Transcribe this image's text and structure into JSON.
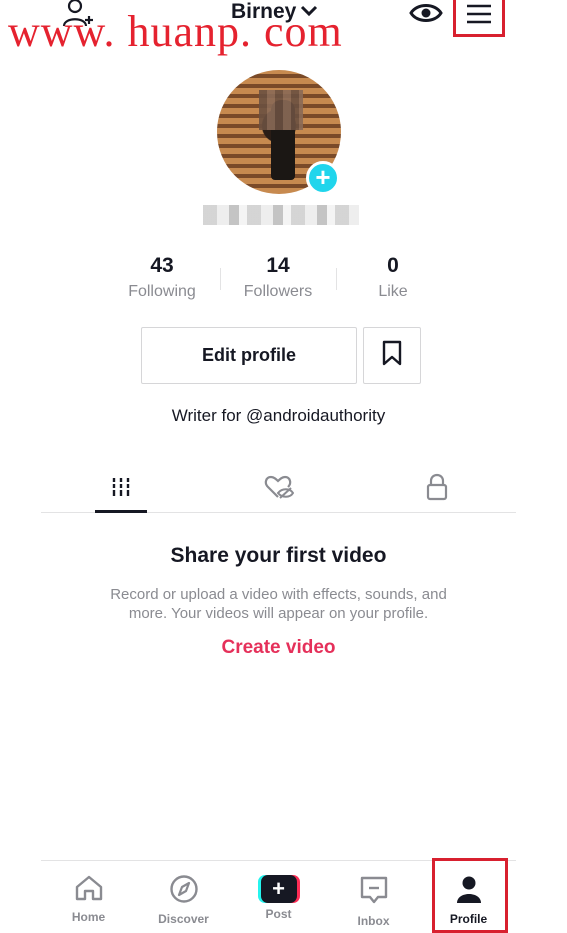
{
  "watermark": "www. huanp. com",
  "header": {
    "username": "Birney",
    "chevron": "chevron-down-icon",
    "left_icon": "add-user-icon",
    "right_icons": [
      "eye-icon",
      "menu-icon"
    ]
  },
  "profile": {
    "avatar_icon": "profile-photo",
    "add_icon": "+",
    "stats": [
      {
        "value": "43",
        "label": "Following"
      },
      {
        "value": "14",
        "label": "Followers"
      },
      {
        "value": "0",
        "label": "Like"
      }
    ],
    "edit_label": "Edit profile",
    "bookmark_icon": "bookmark-icon",
    "bio": "Writer for @androidauthority"
  },
  "tabs": [
    {
      "icon": "grid-icon",
      "active": true
    },
    {
      "icon": "liked-hidden-icon",
      "active": false
    },
    {
      "icon": "lock-icon",
      "active": false
    }
  ],
  "empty_state": {
    "title": "Share your first video",
    "description": "Record or upload a video with effects, sounds, and more. Your videos will appear on your profile.",
    "cta": "Create video"
  },
  "bottom_nav": [
    {
      "label": "Home",
      "icon": "home-icon",
      "active": false
    },
    {
      "label": "Discover",
      "icon": "compass-icon",
      "active": false
    },
    {
      "label": "Post",
      "icon": "plus-icon",
      "active": false
    },
    {
      "label": "Inbox",
      "icon": "inbox-icon",
      "active": false
    },
    {
      "label": "Profile",
      "icon": "person-icon",
      "active": true
    }
  ],
  "colors": {
    "accent": "#e5305a",
    "avatar_plus": "#20d5ec",
    "highlight_box": "#d8202f",
    "text_primary": "#161823",
    "text_secondary": "#8a8b91"
  }
}
